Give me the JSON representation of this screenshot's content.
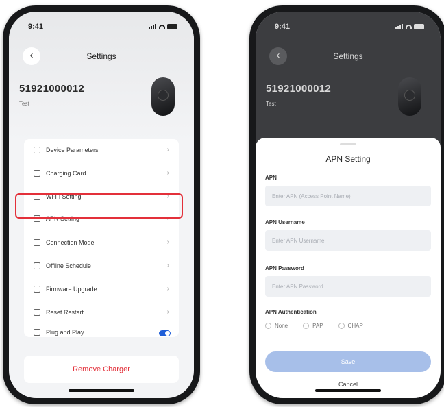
{
  "status_time": "9:41",
  "left_phone": {
    "nav_title": "Settings",
    "back_icon": "‹",
    "device_id": "51921000012",
    "device_sub": "Test",
    "menu": [
      {
        "label": "Device Parameters",
        "icon": "list-icon"
      },
      {
        "label": "Charging Card",
        "icon": "card-icon"
      },
      {
        "label": "Wi-Fi Setting",
        "icon": "wifi-icon"
      },
      {
        "label": "APN Setting",
        "icon": "apn-icon"
      },
      {
        "label": "Connection Mode",
        "icon": "link-icon"
      },
      {
        "label": "Offline Schedule",
        "icon": "clock-icon"
      },
      {
        "label": "Firmware Upgrade",
        "icon": "upgrade-icon"
      },
      {
        "label": "Reset Restart",
        "icon": "reset-icon"
      },
      {
        "label": "Plug and Play",
        "icon": "plug-icon",
        "toggle": true
      }
    ],
    "chevron": "›",
    "remove_label": "Remove Charger",
    "highlight_color": "#e3303a",
    "toggle_color": "#1f5ed8"
  },
  "right_phone": {
    "nav_title": "Settings",
    "back_icon": "‹",
    "device_id": "51921000012",
    "device_sub": "Test",
    "sheet_title": "APN Setting",
    "fields": [
      {
        "label": "APN",
        "placeholder": "Enter APN (Access Point Name)"
      },
      {
        "label": "APN Username",
        "placeholder": "Enter APN Username"
      },
      {
        "label": "APN Password",
        "placeholder": "Enter APN Password"
      }
    ],
    "auth_label": "APN Authentication",
    "auth_options": [
      "None",
      "PAP",
      "CHAP"
    ],
    "save_label": "Save",
    "cancel_label": "Cancel",
    "save_color": "#a7bfe9"
  }
}
